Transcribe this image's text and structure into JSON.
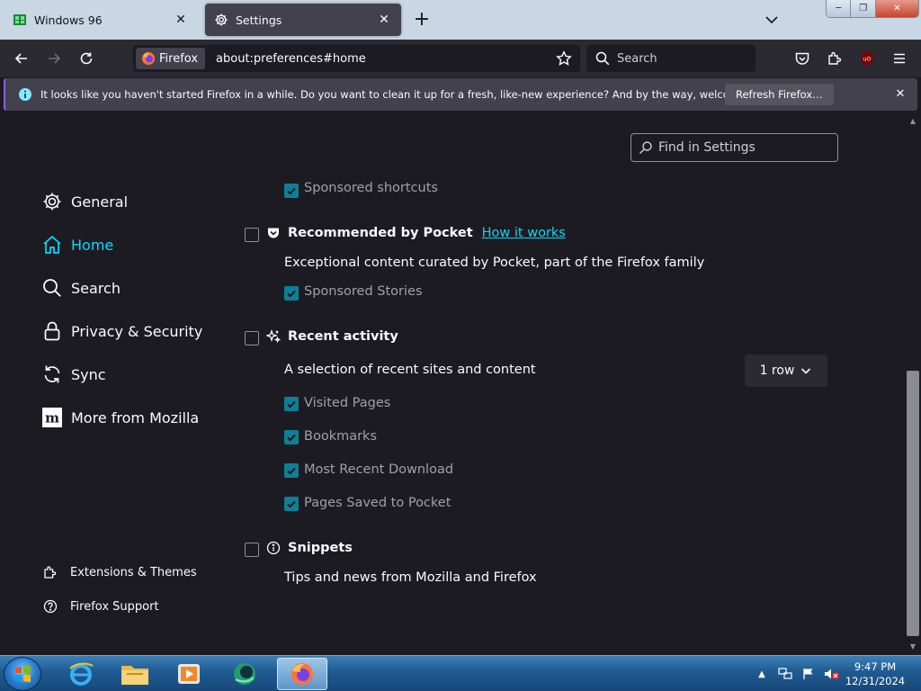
{
  "tabs": [
    {
      "title": "Windows 96",
      "active": false
    },
    {
      "title": "Settings",
      "active": true
    }
  ],
  "tab_close_glyph": "✕",
  "new_tab_glyph": "+",
  "window_controls": {
    "minimize": "─",
    "maximize": "❐",
    "close": "✕"
  },
  "navbar": {
    "identity_label": "Firefox",
    "url": "about:preferences#home",
    "search_placeholder": "Search"
  },
  "notification": {
    "message": "It looks like you haven't started Firefox in a while. Do you want to clean it up for a fresh, like-new experience? And by the way, welcome back!",
    "button_label": "Refresh Firefox…",
    "close_glyph": "✕"
  },
  "find_placeholder": "Find in Settings",
  "sidebar": {
    "items": [
      {
        "label": "General",
        "icon": "gear-icon",
        "selected": false
      },
      {
        "label": "Home",
        "icon": "home-icon",
        "selected": true
      },
      {
        "label": "Search",
        "icon": "search-icon",
        "selected": false
      },
      {
        "label": "Privacy & Security",
        "icon": "lock-icon",
        "selected": false
      },
      {
        "label": "Sync",
        "icon": "sync-icon",
        "selected": false
      },
      {
        "label": "More from Mozilla",
        "icon": "mozilla-icon",
        "selected": false
      }
    ],
    "footer": [
      {
        "label": "Extensions & Themes",
        "icon": "puzzle-icon"
      },
      {
        "label": "Firefox Support",
        "icon": "help-icon"
      }
    ]
  },
  "home": {
    "sponsored_shortcuts": {
      "label": "Sponsored shortcuts",
      "checked": true
    },
    "pocket": {
      "label": "Recommended by Pocket",
      "link": "How it works",
      "checked": false,
      "description": "Exceptional content curated by Pocket, part of the Firefox family",
      "sponsored_stories": {
        "label": "Sponsored Stories",
        "checked": true
      }
    },
    "recent_activity": {
      "label": "Recent activity",
      "checked": false,
      "description": "A selection of recent sites and content",
      "rows_value": "1 row",
      "options": [
        {
          "label": "Visited Pages",
          "checked": true
        },
        {
          "label": "Bookmarks",
          "checked": true
        },
        {
          "label": "Most Recent Download",
          "checked": true
        },
        {
          "label": "Pages Saved to Pocket",
          "checked": true
        }
      ]
    },
    "snippets": {
      "label": "Snippets",
      "checked": false,
      "description": "Tips and news from Mozilla and Firefox"
    }
  },
  "taskbar": {
    "apps": [
      "internet-explorer-icon",
      "file-explorer-icon",
      "media-player-icon",
      "green-app-icon",
      "firefox-icon"
    ],
    "active_app": "firefox-icon",
    "tray_show_hidden": "▲",
    "clock_time": "9:47 PM",
    "clock_date": "12/31/2024"
  },
  "colors": {
    "accent": "#00ddff",
    "checkbox_checked": "#0e7f96",
    "page_bg": "#1c1b22",
    "toolbar_bg": "#2b2a33",
    "notification_accent": "#9059ff"
  }
}
